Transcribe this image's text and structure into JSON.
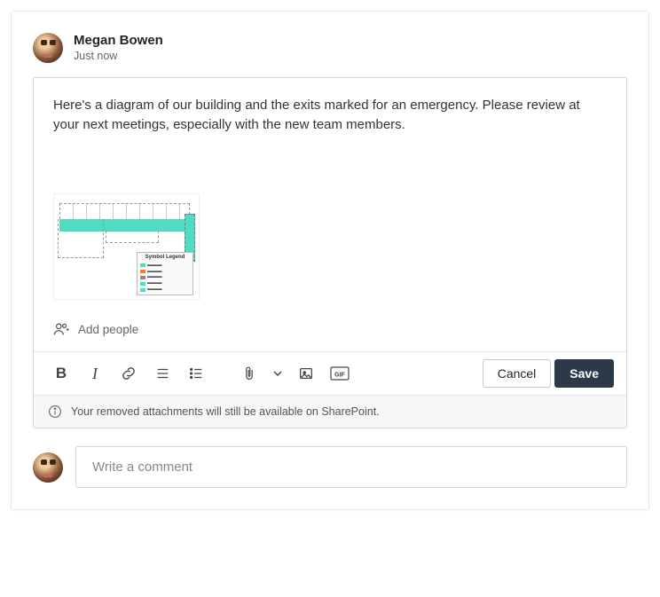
{
  "post": {
    "author_name": "Megan Bowen",
    "timestamp": "Just now",
    "body": "Here's a diagram of our building and the exits marked for an emergency. Please review at your next meetings, especially with the new team members.",
    "attachment": {
      "legend_title": "Symbol Legend"
    }
  },
  "add_people": {
    "label": "Add people"
  },
  "toolbar": {
    "bold": "B",
    "italic": "I",
    "cancel_label": "Cancel",
    "save_label": "Save"
  },
  "info_bar": {
    "message": "Your removed attachments will still be available on SharePoint."
  },
  "comment_box": {
    "placeholder": "Write a comment"
  }
}
